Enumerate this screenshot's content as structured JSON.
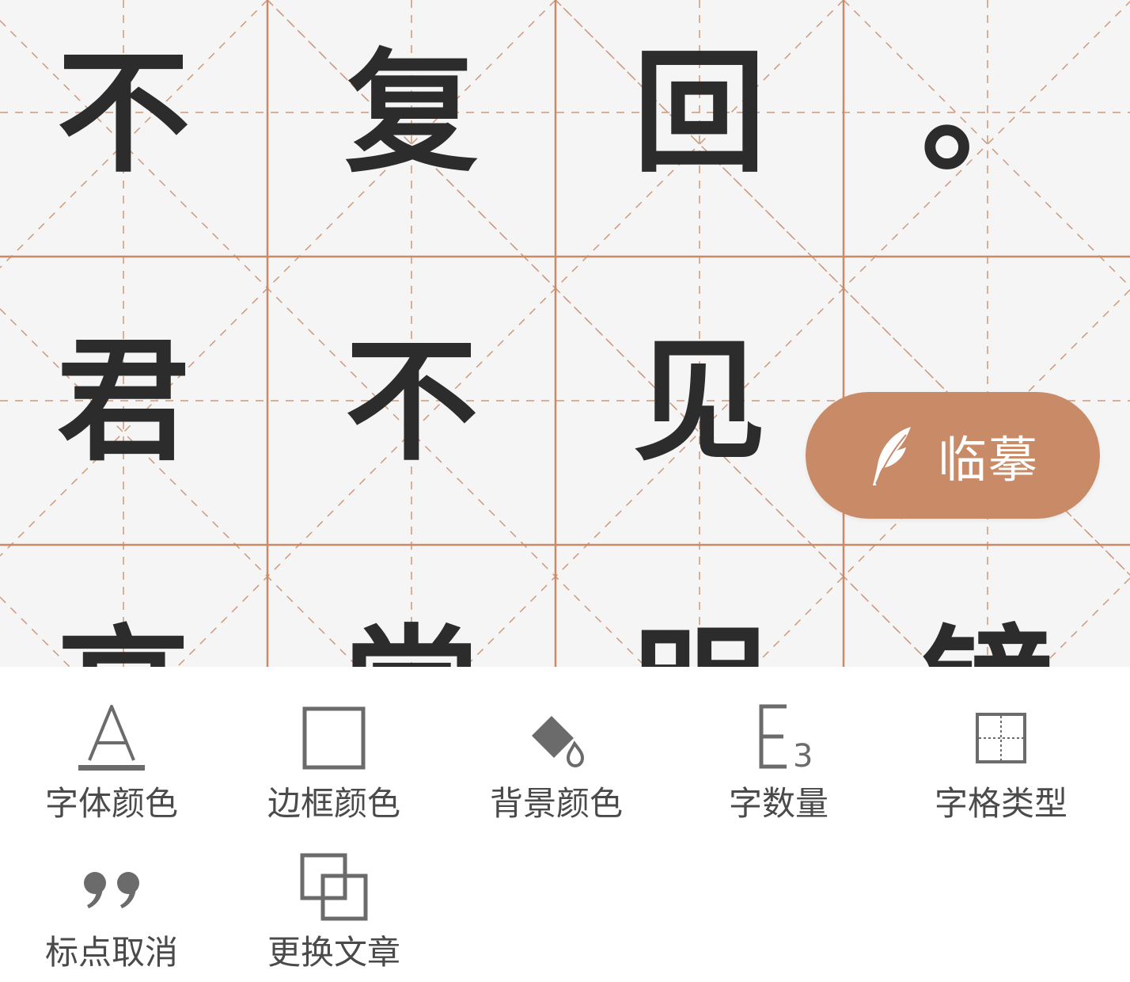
{
  "grid": {
    "line_color": "#c88a67",
    "background": "#f5f5f5",
    "rows": [
      [
        "不",
        "复",
        "回",
        "。"
      ],
      [
        "君",
        "不",
        "见",
        ""
      ],
      [
        "高",
        "堂",
        "明",
        "镜"
      ]
    ]
  },
  "trace_button": {
    "label": "临摹",
    "color": "#c88a67",
    "icon": "feather-icon"
  },
  "toolbar": {
    "items": [
      {
        "label": "字体颜色",
        "icon": "font-color-icon"
      },
      {
        "label": "边框颜色",
        "icon": "border-color-icon"
      },
      {
        "label": "背景颜色",
        "icon": "background-color-icon"
      },
      {
        "label": "字数量",
        "icon": "character-count-icon"
      },
      {
        "label": "字格类型",
        "icon": "grid-type-icon"
      },
      {
        "label": "标点取消",
        "icon": "punctuation-icon"
      },
      {
        "label": "更换文章",
        "icon": "change-article-icon"
      }
    ],
    "icon_color": "#6b6b6b",
    "text_color": "#4a4a4a"
  }
}
